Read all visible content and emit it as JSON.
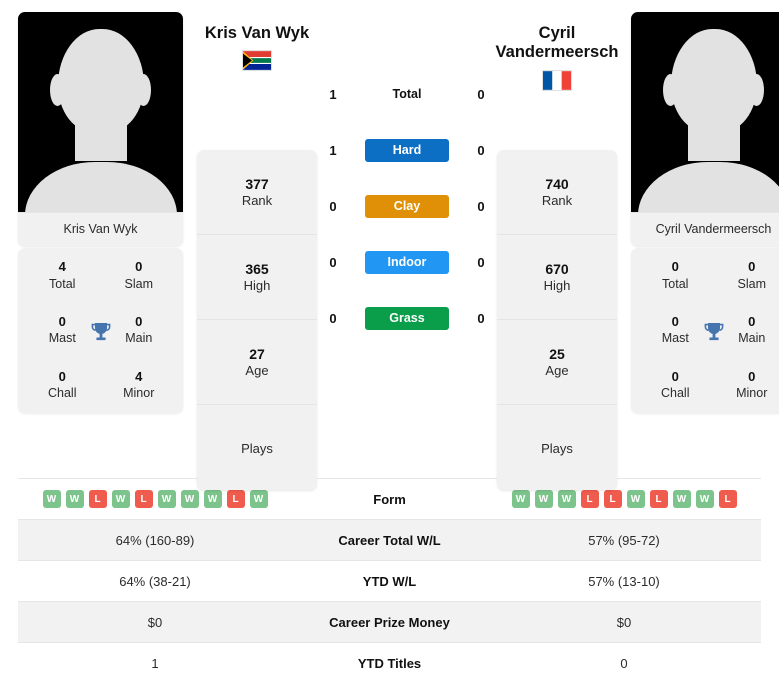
{
  "colors": {
    "hard": "#0d6fc4",
    "clay": "#e09007",
    "indoor": "#2196f3",
    "grass": "#0a9e4a",
    "win": "#7cc48c",
    "loss": "#ef5b4c",
    "trophy": "#4574ae",
    "card_bg": "#f1f1f1",
    "row_alt": "#f2f2f2"
  },
  "left_player": {
    "name": "Kris Van Wyk",
    "photo_caption": "Kris Van Wyk",
    "flag": "south-africa-flag",
    "titles": [
      {
        "value": "4",
        "label": "Total"
      },
      {
        "value": "0",
        "label": "Slam"
      },
      {
        "value": "0",
        "label": "Mast"
      },
      {
        "value": "0",
        "label": "Main"
      },
      {
        "value": "0",
        "label": "Chall"
      },
      {
        "value": "4",
        "label": "Minor"
      }
    ],
    "stats": [
      {
        "value": "377",
        "label": "Rank"
      },
      {
        "value": "365",
        "label": "High"
      },
      {
        "value": "27",
        "label": "Age"
      },
      {
        "value": "",
        "label": "Plays"
      }
    ]
  },
  "right_player": {
    "name": "Cyril Vandermeersch",
    "photo_caption": "Cyril Vandermeersch",
    "flag": "france-flag",
    "titles": [
      {
        "value": "0",
        "label": "Total"
      },
      {
        "value": "0",
        "label": "Slam"
      },
      {
        "value": "0",
        "label": "Mast"
      },
      {
        "value": "0",
        "label": "Main"
      },
      {
        "value": "0",
        "label": "Chall"
      },
      {
        "value": "0",
        "label": "Minor"
      }
    ],
    "stats": [
      {
        "value": "740",
        "label": "Rank"
      },
      {
        "value": "670",
        "label": "High"
      },
      {
        "value": "25",
        "label": "Age"
      },
      {
        "value": "",
        "label": "Plays"
      }
    ]
  },
  "surfaces": [
    {
      "label": "Total",
      "left": "1",
      "right": "0",
      "badge": false
    },
    {
      "label": "Hard",
      "left": "1",
      "right": "0",
      "badge": true,
      "color": "#0d6fc4"
    },
    {
      "label": "Clay",
      "left": "0",
      "right": "0",
      "badge": true,
      "color": "#e09007"
    },
    {
      "label": "Indoor",
      "left": "0",
      "right": "0",
      "badge": true,
      "color": "#2196f3"
    },
    {
      "label": "Grass",
      "left": "0",
      "right": "0",
      "badge": true,
      "color": "#0a9e4a"
    }
  ],
  "table": {
    "form": {
      "label": "Form",
      "left": [
        "W",
        "W",
        "L",
        "W",
        "L",
        "W",
        "W",
        "W",
        "L",
        "W"
      ],
      "right": [
        "W",
        "W",
        "W",
        "L",
        "L",
        "W",
        "L",
        "W",
        "W",
        "L"
      ]
    },
    "rows": [
      {
        "label": "Career Total W/L",
        "left": "64% (160-89)",
        "right": "57% (95-72)"
      },
      {
        "label": "YTD W/L",
        "left": "64% (38-21)",
        "right": "57% (13-10)"
      },
      {
        "label": "Career Prize Money",
        "left": "$0",
        "right": "$0"
      },
      {
        "label": "YTD Titles",
        "left": "1",
        "right": "0"
      }
    ]
  }
}
